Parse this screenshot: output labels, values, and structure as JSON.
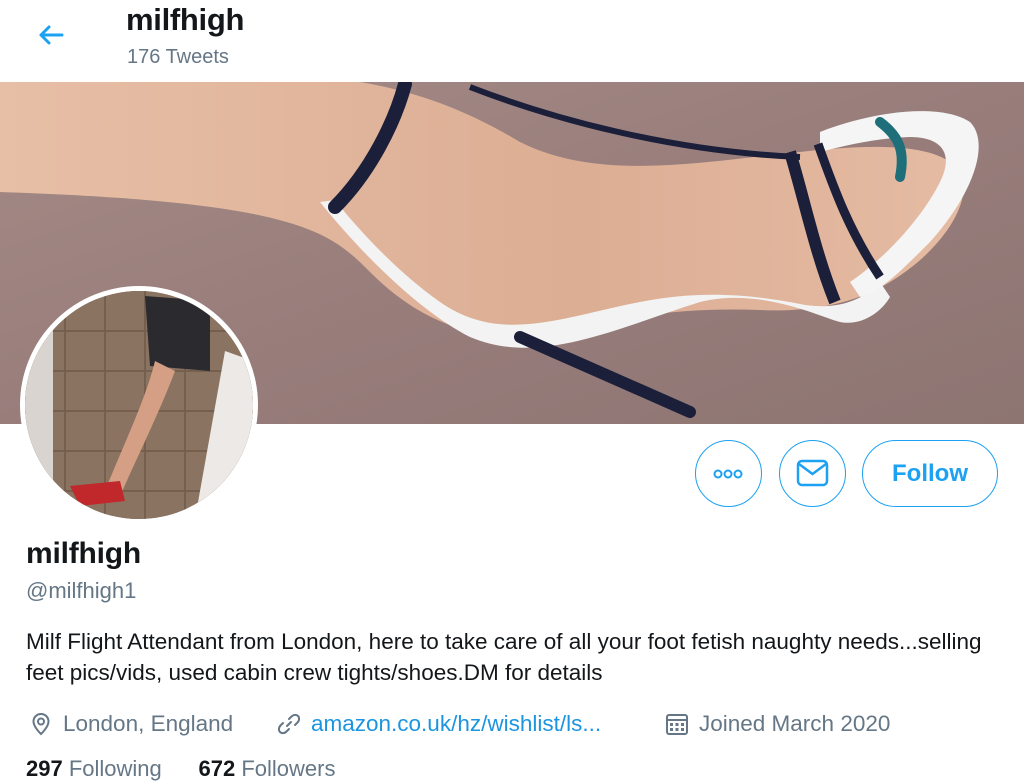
{
  "header": {
    "title": "milfhigh",
    "tweet_count": "176 Tweets"
  },
  "actions": {
    "follow_label": "Follow"
  },
  "profile": {
    "display_name": "milfhigh",
    "handle": "@milfhigh1",
    "bio": "Milf Flight Attendant from London, here to take care of all your foot fetish naughty needs...selling feet pics/vids, used cabin crew tights/shoes.DM for details",
    "location": "London, England",
    "website": "amazon.co.uk/hz/wishlist/ls...",
    "joined": "Joined March 2020"
  },
  "stats": {
    "following_count": "297",
    "following_label": "Following",
    "followers_count": "672",
    "followers_label": "Followers"
  },
  "colors": {
    "accent": "#1da1f2",
    "link": "#1b95e0",
    "secondary_text": "#657786"
  },
  "icons": {
    "back": "arrow-left-icon",
    "more": "more-dots-icon",
    "message": "envelope-icon",
    "location": "location-pin-icon",
    "link": "link-icon",
    "calendar": "calendar-icon"
  }
}
